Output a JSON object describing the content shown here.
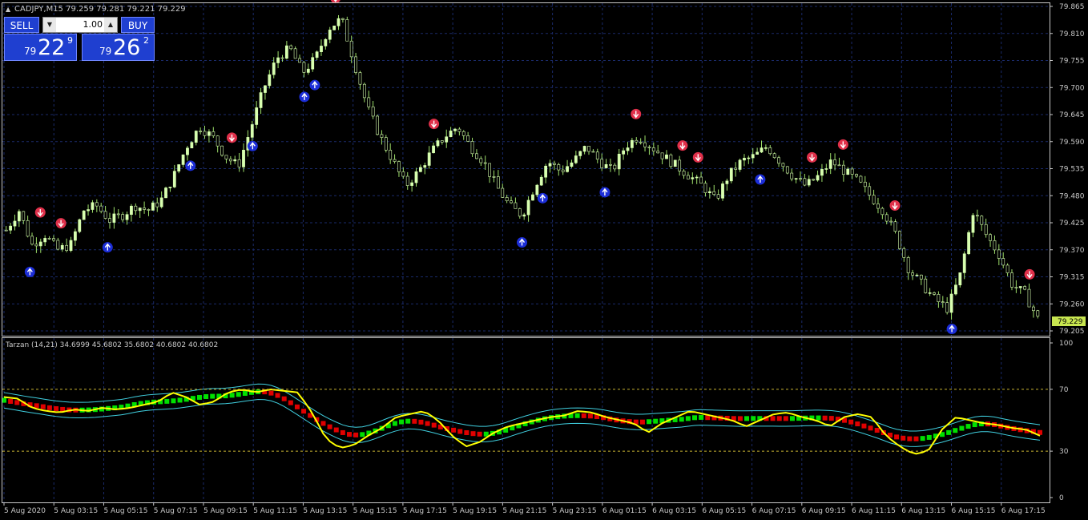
{
  "chart_header": "CADJPY,M15  79.259 79.281 79.221 79.229",
  "trade_panel": {
    "sell_label": "SELL",
    "buy_label": "BUY",
    "lot_value": "1.00",
    "sell_price": {
      "prefix": "79",
      "big": "22",
      "sup": "9"
    },
    "buy_price": {
      "prefix": "79",
      "big": "26",
      "sup": "2"
    }
  },
  "price_axis": [
    "79.865",
    "79.810",
    "79.755",
    "79.700",
    "79.645",
    "79.590",
    "79.535",
    "79.480",
    "79.425",
    "79.370",
    "79.315",
    "79.260",
    "79.205"
  ],
  "current_price": "79.229",
  "indicator": {
    "label": "Tarzan (14,21) 34.6999 45.6802 35.6802 40.6802 40.6802",
    "levels": [
      "100",
      "70",
      "30",
      "0"
    ]
  },
  "time_axis": [
    "5 Aug 2020",
    "5 Aug 03:15",
    "5 Aug 05:15",
    "5 Aug 07:15",
    "5 Aug 09:15",
    "5 Aug 11:15",
    "5 Aug 13:15",
    "5 Aug 15:15",
    "5 Aug 17:15",
    "5 Aug 19:15",
    "5 Aug 21:15",
    "5 Aug 23:15",
    "6 Aug 01:15",
    "6 Aug 03:15",
    "6 Aug 05:15",
    "6 Aug 07:15",
    "6 Aug 09:15",
    "6 Aug 11:15",
    "6 Aug 13:15",
    "6 Aug 15:15",
    "6 Aug 17:15"
  ],
  "colors": {
    "grid": "#1a2a6a",
    "axis": "#c8c8c8",
    "bull_candle": "#d8ffb0",
    "wick": "#9ee06a",
    "sell_arrow": "#e0304a",
    "buy_arrow": "#1c2ed8",
    "rsi_line": "#ffff00",
    "band": "#40d0e0",
    "ma_up": "#00e000",
    "ma_down": "#e00000",
    "panel": "#1f3fd0"
  },
  "chart_data": {
    "type": "candlestick",
    "price_ylim": [
      79.205,
      79.865
    ],
    "close_path": [
      79.41,
      79.45,
      79.38,
      79.4,
      79.37,
      79.38,
      79.45,
      79.46,
      79.43,
      79.44,
      79.46,
      79.45,
      79.47,
      79.52,
      79.58,
      79.62,
      79.6,
      79.56,
      79.54,
      79.62,
      79.7,
      79.76,
      79.78,
      79.73,
      79.76,
      79.82,
      79.84,
      79.75,
      79.66,
      79.6,
      79.55,
      79.5,
      79.53,
      79.57,
      79.6,
      79.62,
      79.58,
      79.55,
      79.5,
      79.46,
      79.44,
      79.5,
      79.55,
      79.53,
      79.55,
      79.58,
      79.55,
      79.53,
      79.58,
      79.6,
      79.58,
      79.56,
      79.54,
      79.52,
      79.5,
      79.47,
      79.52,
      79.55,
      79.56,
      79.58,
      79.55,
      79.52,
      79.5,
      79.52,
      79.55,
      79.53,
      79.51,
      79.48,
      79.45,
      79.4,
      79.33,
      79.3,
      79.27,
      79.25,
      79.32,
      79.45,
      79.4,
      79.36,
      79.3,
      79.28,
      79.23
    ],
    "oscillator_ylim": [
      0,
      100
    ],
    "oscillator_path": [
      65,
      64,
      58,
      56,
      55,
      57,
      56,
      58,
      57,
      58,
      60,
      62,
      68,
      65,
      60,
      62,
      68,
      70,
      68,
      70,
      69,
      68,
      55,
      38,
      32,
      34,
      40,
      45,
      52,
      54,
      56,
      50,
      40,
      33,
      36,
      42,
      46,
      48,
      50,
      52,
      53,
      56,
      55,
      52,
      50,
      48,
      42,
      48,
      52,
      56,
      54,
      52,
      50,
      46,
      50,
      54,
      55,
      52,
      50,
      46,
      52,
      54,
      52,
      40,
      33,
      28,
      30,
      44,
      52,
      50,
      48,
      47,
      45,
      44,
      40
    ]
  }
}
